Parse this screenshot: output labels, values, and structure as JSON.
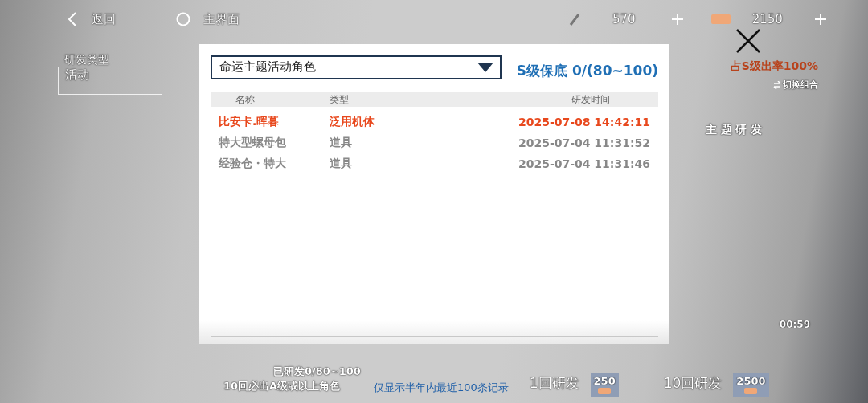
{
  "top_bar": {
    "back_label": "返回",
    "home_label": "主界面",
    "currencies": [
      {
        "amount": "570"
      },
      {
        "amount": "2150"
      }
    ]
  },
  "side_panel": {
    "title": "研发类型",
    "item": "活动"
  },
  "banner": {
    "rate": "占S级出率100%",
    "switch_label": "切换组合",
    "heading": "主 题 研 发",
    "timer": "00:59"
  },
  "footer": {
    "progress": "已研发0/80~100",
    "hint": "10回必出A级或以上角色",
    "note": "仅显示半年内最近100条记录",
    "pulls": [
      {
        "label": "1回研发",
        "cost": "250"
      },
      {
        "label": "10回研发",
        "cost": "2500"
      }
    ]
  },
  "dialog": {
    "filter": {
      "value": "命运主题活动角色"
    },
    "pity": "S级保底 0/(80~100)",
    "columns": [
      "名称",
      "类型",
      "研发时间"
    ],
    "rows": [
      {
        "name": "比安卡.晖暮",
        "type": "泛用机体",
        "time": "2025-07-08 14:42:11",
        "highlighted": true
      },
      {
        "name": "特大型螺母包",
        "type": "道具",
        "time": "2025-07-04 11:31:52",
        "highlighted": false
      },
      {
        "name": "经验仓・特大",
        "type": "道具",
        "time": "2025-07-04 11:31:46",
        "highlighted": false
      }
    ]
  }
}
